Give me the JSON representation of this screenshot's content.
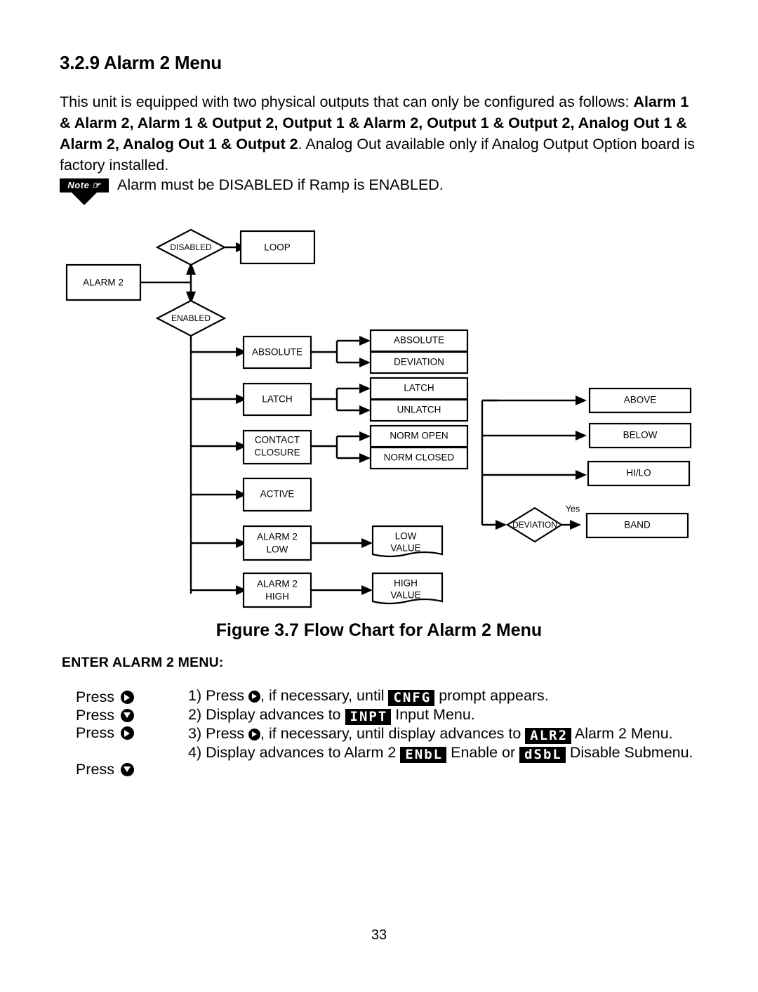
{
  "section": {
    "number": "3.2.9",
    "title": "Alarm 2 Menu",
    "heading": "3.2.9 Alarm 2 Menu"
  },
  "intro": {
    "part1": "This unit is equipped with two physical outputs that can only be configured as follows: ",
    "bold": "Alarm 1 & Alarm 2, Alarm 1 & Output 2, Output 1 & Alarm 2, Output 1 & Output 2, Analog Out 1 & Alarm 2, Analog Out 1 & Output 2",
    "part2": ". Analog Out available only if Analog Output Option board is factory installed."
  },
  "note": {
    "badge": "Note",
    "text": "Alarm must be DISABLED if Ramp is ENABLED."
  },
  "chart_data": {
    "type": "diagram",
    "title": "Figure 3.7 Flow Chart for Alarm 2 Menu",
    "nodes": [
      {
        "id": "alarm2",
        "label": "ALARM 2",
        "shape": "rect"
      },
      {
        "id": "disabled",
        "label": "DISABLED",
        "shape": "diamond"
      },
      {
        "id": "loop",
        "label": "LOOP",
        "shape": "rect"
      },
      {
        "id": "enabled",
        "label": "ENABLED",
        "shape": "diamond"
      },
      {
        "id": "absolute",
        "label": "ABSOLUTE",
        "shape": "rect"
      },
      {
        "id": "absolute2",
        "label": "ABSOLUTE",
        "shape": "rect"
      },
      {
        "id": "deviation",
        "label": "DEVIATION",
        "shape": "rect"
      },
      {
        "id": "latch",
        "label": "LATCH",
        "shape": "rect"
      },
      {
        "id": "latch2",
        "label": "LATCH",
        "shape": "rect"
      },
      {
        "id": "unlatch",
        "label": "UNLATCH",
        "shape": "rect"
      },
      {
        "id": "contact",
        "label": "CONTACT CLOSURE",
        "shape": "rect"
      },
      {
        "id": "normopen",
        "label": "NORM OPEN",
        "shape": "rect"
      },
      {
        "id": "normclosed",
        "label": "NORM CLOSED",
        "shape": "rect"
      },
      {
        "id": "active",
        "label": "ACTIVE",
        "shape": "rect"
      },
      {
        "id": "alarm2low",
        "label": "ALARM 2 LOW",
        "shape": "rect"
      },
      {
        "id": "lowvalue",
        "label": "LOW VALUE",
        "shape": "doc"
      },
      {
        "id": "alarm2high",
        "label": "ALARM 2 HIGH",
        "shape": "rect"
      },
      {
        "id": "highvalue",
        "label": "HIGH VALUE",
        "shape": "doc"
      },
      {
        "id": "above",
        "label": "ABOVE",
        "shape": "rect"
      },
      {
        "id": "below",
        "label": "BELOW",
        "shape": "rect"
      },
      {
        "id": "hilo",
        "label": "HI/LO",
        "shape": "rect"
      },
      {
        "id": "deviation_d",
        "label": "DEVIATION",
        "shape": "diamond"
      },
      {
        "id": "band",
        "label": "BAND",
        "shape": "rect"
      }
    ],
    "edge_labels": [
      "Yes"
    ]
  },
  "flowchart": {
    "alarm2": "ALARM 2",
    "disabled": "DISABLED",
    "loop": "LOOP",
    "enabled": "ENABLED",
    "absolute": "ABSOLUTE",
    "absolute_r": "ABSOLUTE",
    "deviation_r": "DEVIATION",
    "latch": "LATCH",
    "latch_r": "LATCH",
    "unlatch": "UNLATCH",
    "contact_l1": "CONTACT",
    "contact_l2": "CLOSURE",
    "norm_open": "NORM OPEN",
    "norm_closed": "NORM CLOSED",
    "active": "ACTIVE",
    "alarm2low_l1": "ALARM 2",
    "alarm2low_l2": "LOW",
    "lowvalue_l1": "LOW",
    "lowvalue_l2": "VALUE",
    "alarm2high_l1": "ALARM 2",
    "alarm2high_l2": "HIGH",
    "highvalue_l1": "HIGH",
    "highvalue_l2": "VALUE",
    "above": "ABOVE",
    "below": "BELOW",
    "hilo": "HI/LO",
    "deviation_d": "DEVIATION",
    "yes": "Yes",
    "band": "BAND"
  },
  "figure": {
    "caption": "Figure 3.7 Flow Chart for Alarm 2 Menu"
  },
  "enter_menu": {
    "heading": "ENTER ALARM 2 MENU:",
    "press_label": "Press",
    "presses": [
      {
        "label": "Press",
        "icon": "arrow-right-button-icon"
      },
      {
        "label": "Press",
        "icon": "arrow-down-button-icon"
      },
      {
        "label": "Press",
        "icon": "arrow-right-button-icon"
      },
      {
        "label": "Press",
        "icon": "arrow-down-button-icon"
      }
    ],
    "steps": [
      {
        "number": "1)",
        "text_a": "Press ",
        "text_b": ", if necessary, until ",
        "lcd": "CNFG",
        "text_c": " prompt appears."
      },
      {
        "number": "2)",
        "text_a": "Display advances to ",
        "lcd": "INPT",
        "text_c": " Input Menu."
      },
      {
        "number": "3)",
        "text_a": "Press ",
        "text_b": ", if necessary, until display advances to ",
        "lcd": "ALR2",
        "text_c": " Alarm 2 Menu."
      },
      {
        "number": "4)",
        "text_a": "Display advances to Alarm 2 ",
        "lcd": "ENbL",
        "text_b": " Enable or ",
        "lcd2": "dSbL",
        "text_c": " Disable Submenu."
      }
    ]
  },
  "page_number": "33"
}
